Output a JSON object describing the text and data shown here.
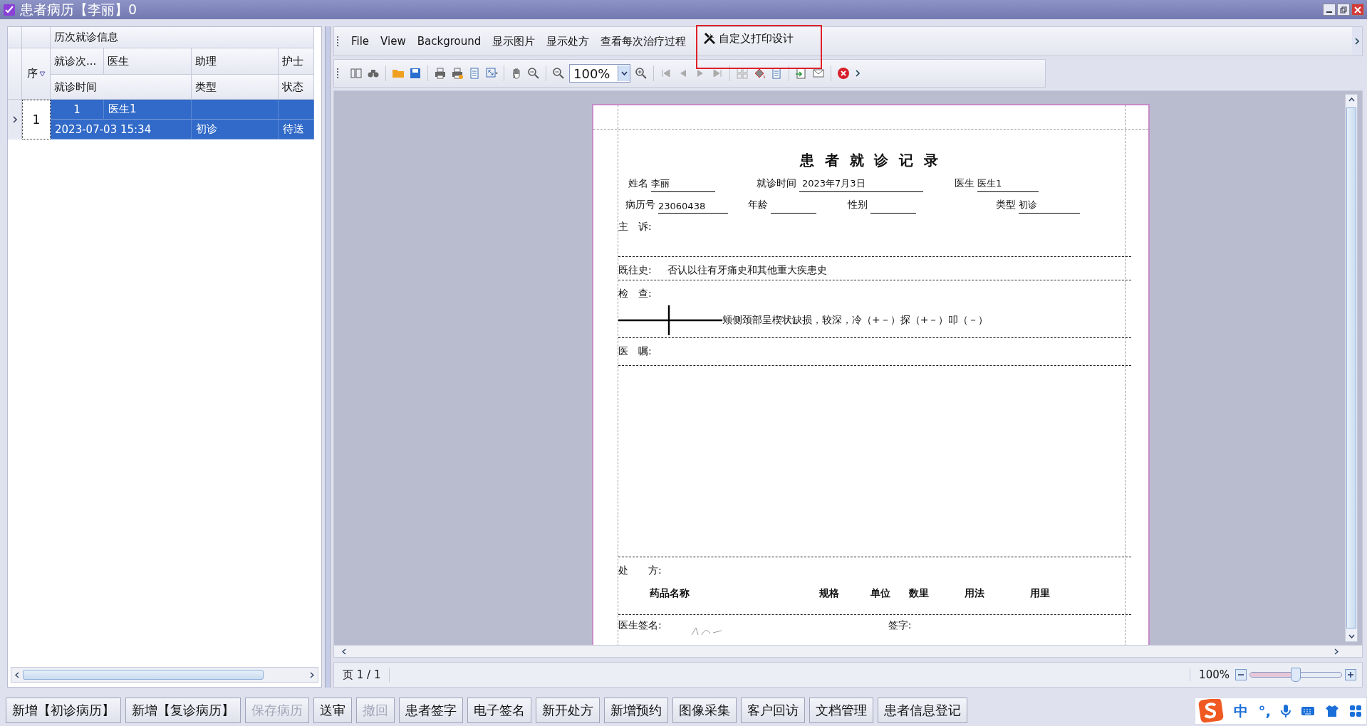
{
  "window": {
    "title": "患者病历【李丽】0"
  },
  "visit_grid": {
    "band": "历次就诊信息",
    "seq_header": "序",
    "columns_row1": [
      "就诊次...",
      "医生",
      "助理",
      "护士"
    ],
    "columns_row2": [
      "就诊时间",
      "类型",
      "状态"
    ],
    "rows": [
      {
        "seq": "1",
        "selected": true,
        "visit_no": "1",
        "doctor": "医生1",
        "time": "2023-07-03 15:34",
        "type": "初诊",
        "status": "待送"
      }
    ]
  },
  "menu": [
    {
      "label": "File",
      "kind": "text",
      "annotated": false
    },
    {
      "label": "View",
      "kind": "text",
      "annotated": false
    },
    {
      "label": "Background",
      "kind": "text",
      "annotated": false
    },
    {
      "label": "显示图片",
      "kind": "text",
      "annotated": false
    },
    {
      "label": "显示处方",
      "kind": "text",
      "annotated": false
    },
    {
      "label": "查看每次治疗过程",
      "kind": "text",
      "annotated": false
    },
    {
      "label": "自定义打印设计",
      "kind": "tool",
      "annotated": true
    }
  ],
  "toolbar": {
    "zoom": "100%"
  },
  "document": {
    "title": "患 者 就 诊 记 录",
    "fields_row1": [
      {
        "label": "姓名",
        "value": "李丽"
      },
      {
        "label": "就诊时间",
        "value": "2023年7月3日"
      },
      {
        "label": "医生",
        "value": "医生1"
      }
    ],
    "fields_row2": [
      {
        "label": "病历号",
        "value": "23060438"
      },
      {
        "label": "年龄"
      },
      {
        "label": "性别"
      },
      {
        "label": "类型",
        "value": "初诊"
      }
    ],
    "complaint": "主　诉:",
    "history_label": "既往史:",
    "history": "否认以往有牙痛史和其他重大疾患史",
    "exam_label": "检　查:",
    "exam": "颊侧颈部呈楔状缺损，较深，冷（+－）探（+－）叩（－）",
    "advice": "医　嘱:",
    "rx_label": "处　　方:",
    "rx_columns": [
      "药品名称",
      "规格",
      "单位",
      "数里",
      "用法",
      "用里"
    ],
    "doctor_sign": "医生签名:",
    "sign": "签字:"
  },
  "status_bar": {
    "page": "页 1 / 1",
    "zoom": "100%",
    "level": 0.5
  },
  "buttons": [
    {
      "label": "新增【初诊病历】",
      "disabled": false
    },
    {
      "label": "新增【复诊病历】",
      "disabled": false
    },
    {
      "label": "保存病历",
      "disabled": true
    },
    {
      "label": "送审",
      "disabled": false
    },
    {
      "label": "撤回",
      "disabled": true
    },
    {
      "label": "患者签字",
      "disabled": false
    },
    {
      "label": "电子签名",
      "disabled": false
    },
    {
      "label": "新开处方",
      "disabled": false
    },
    {
      "label": "新增预约",
      "disabled": false
    },
    {
      "label": "图像采集",
      "disabled": false
    },
    {
      "label": "客户回访",
      "disabled": false
    },
    {
      "label": "文档管理",
      "disabled": false
    },
    {
      "label": "患者信息登记",
      "disabled": false
    }
  ],
  "ime": {
    "items": [
      "中",
      "°,"
    ]
  }
}
